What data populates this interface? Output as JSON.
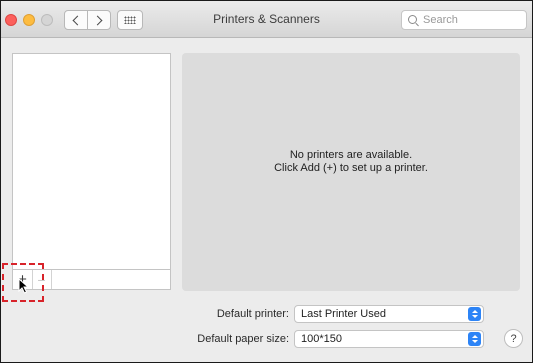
{
  "window": {
    "title": "Printers & Scanners"
  },
  "search": {
    "placeholder": "Search"
  },
  "toolbar": {
    "add_label": "+",
    "remove_label": "−"
  },
  "detail": {
    "empty_line1": "No printers are available.",
    "empty_line2": "Click Add (+) to set up a printer."
  },
  "settings": {
    "default_printer_label": "Default printer:",
    "default_printer_value": "Last Printer Used",
    "default_paper_label": "Default paper size:",
    "default_paper_value": "100*150"
  },
  "help": {
    "label": "?"
  },
  "colors": {
    "accent": "#2d84f6",
    "highlight": "#d8232a",
    "close": "#fc605c",
    "minimize": "#fdbc40"
  },
  "icons": [
    "close-icon",
    "minimize-icon",
    "zoom-icon",
    "back-chevron-icon",
    "forward-chevron-icon",
    "grid-icon",
    "search-icon",
    "cursor-icon"
  ]
}
